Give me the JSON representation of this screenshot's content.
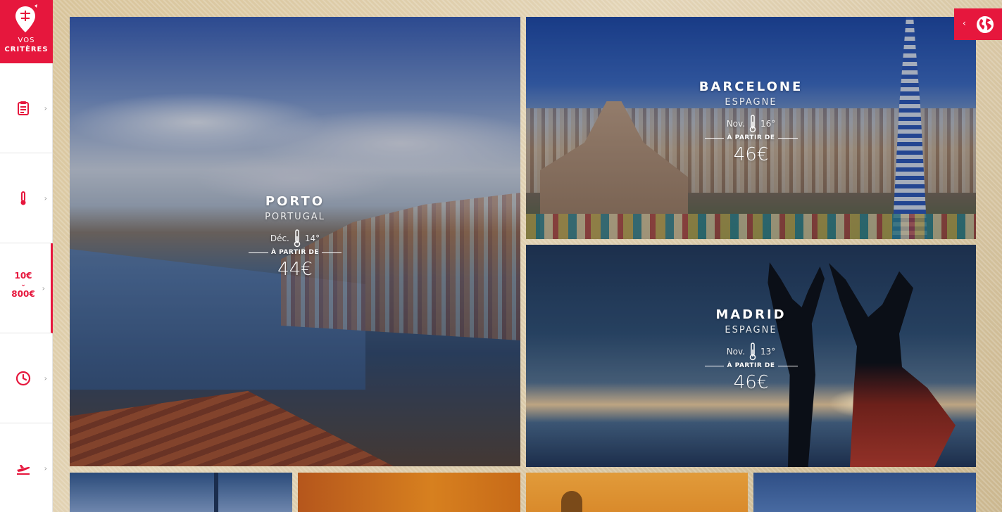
{
  "sidebar": {
    "logo": {
      "line1": "VOS",
      "line2": "CRITÈRES"
    },
    "price": {
      "min": "10€",
      "separator": "⌄",
      "max": "800€"
    },
    "items": [
      {
        "icon": "clipboard-icon",
        "chevron": "›"
      },
      {
        "icon": "thermometer-icon",
        "chevron": "›"
      },
      {
        "icon": "price-icon",
        "chevron": "›"
      },
      {
        "icon": "clock-icon",
        "chevron": "›"
      },
      {
        "icon": "plane-icon",
        "chevron": "›"
      }
    ]
  },
  "map_toggle": {
    "chevron": "‹",
    "icon": "globe-icon"
  },
  "destinations": [
    {
      "city": "PORTO",
      "country": "PORTUGAL",
      "month": "Déc.",
      "temp": "14°",
      "from_label": "À PARTIR DE",
      "price": "44€"
    },
    {
      "city": "BARCELONE",
      "country": "ESPAGNE",
      "month": "Nov.",
      "temp": "16°",
      "from_label": "À PARTIR DE",
      "price": "46€"
    },
    {
      "city": "MADRID",
      "country": "ESPAGNE",
      "month": "Nov.",
      "temp": "13°",
      "from_label": "À PARTIR DE",
      "price": "46€"
    }
  ],
  "colors": {
    "accent": "#e6173d",
    "sidebar_bg": "#ffffff",
    "page_bg": "#e3d4b6"
  }
}
